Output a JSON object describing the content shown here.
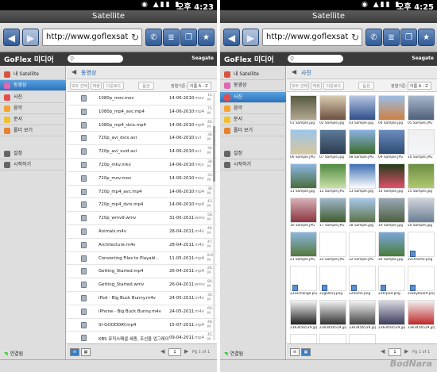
{
  "left": {
    "status": {
      "time": "오후 4:23"
    },
    "window_title": "Satellite",
    "url": "http://www.goflexsat",
    "app_name": "GoFlex 미디어",
    "brand": "Seagate",
    "sidebar": [
      {
        "label": "내 Satellite",
        "color": "#d9533d",
        "selected": false
      },
      {
        "label": "동영상",
        "color": "#e266b4",
        "selected": true
      },
      {
        "label": "사진",
        "color": "#e74c4c",
        "selected": false
      },
      {
        "label": "음악",
        "color": "#f2a531",
        "selected": false
      },
      {
        "label": "문서",
        "color": "#f0c02d",
        "selected": false
      },
      {
        "label": "폴더 보기",
        "color": "#e8822b",
        "selected": false
      },
      {
        "label": "설정",
        "color": "#666666",
        "selected": false
      },
      {
        "label": "시작하기",
        "color": "#666666",
        "selected": false
      }
    ],
    "footer_label": "연결됨",
    "section_title": "동영상",
    "toolbar": {
      "btn1": "모두 선택",
      "btn2": "재생",
      "btn3": "다운로드",
      "btn4": "옵션",
      "sort_label": "정렬기준:",
      "sort_value": "이름 A - Z"
    },
    "files": [
      {
        "name": "1080p_mov.mov",
        "date": "14-06-2010",
        "ext": "mov",
        "size": "14.7 M"
      },
      {
        "name": "1080p_mp4_avc.mp4",
        "date": "14-06-2010",
        "ext": "mp4",
        "size": "75.1 M"
      },
      {
        "name": "1080p_mp4_dvix.mp4",
        "date": "14-06-2010",
        "ext": "mp4",
        "size": "46.5 M"
      },
      {
        "name": "720p_avi_dvix.avi",
        "date": "14-06-2010",
        "ext": "avi",
        "size": "38.8 M"
      },
      {
        "name": "720p_avi_xvid.avi",
        "date": "14-06-2010",
        "ext": "avi",
        "size": "34.7 M"
      },
      {
        "name": "720p_mkv.mkv",
        "date": "14-06-2010",
        "ext": "mkv",
        "size": "38.6 M"
      },
      {
        "name": "720p_mov.mov",
        "date": "14-06-2010",
        "ext": "mov",
        "size": "33.5 M"
      },
      {
        "name": "720p_mp4_avc.mp4",
        "date": "14-06-2010",
        "ext": "mp4",
        "size": "38.6 M"
      },
      {
        "name": "720p_mp4_dvix.mp4",
        "date": "14-06-2010",
        "ext": "mp4",
        "size": "43.6 M"
      },
      {
        "name": "720p_wmv9.wmv",
        "date": "31-05-2011",
        "ext": "wmv",
        "size": "58.9 M"
      },
      {
        "name": "Animals.m4v",
        "date": "28-04-2011",
        "ext": "m4v",
        "size": "46.5 M"
      },
      {
        "name": "Architecture.m4v",
        "date": "28-04-2011",
        "ext": "m4v",
        "size": "47.9 M"
      },
      {
        "name": "Converting Files to Playabl...",
        "date": "11-05-2011",
        "ext": "mp4",
        "size": "8.6 M"
      },
      {
        "name": "Getting_Started.mp4",
        "date": "26-04-2011",
        "ext": "mp4",
        "size": "26.7 M"
      },
      {
        "name": "Getting_Started.wmv",
        "date": "26-04-2011",
        "ext": "wmv",
        "size": "80.0 M"
      },
      {
        "name": "iPod - Big Buck Bunny.m4v",
        "date": "24-05-2011",
        "ext": "m4v",
        "size": "36.3 M"
      },
      {
        "name": "iPhone - Big Buck Bunny.m4v",
        "date": "24-05-2011",
        "ext": "m4v",
        "size": "60.3 M"
      },
      {
        "name": "SI-GOODDAY.mp4",
        "date": "15-07-2011",
        "ext": "mp4",
        "size": "48.4 M"
      },
      {
        "name": "KBS 뮤직스페셜 세종, 조선을 업그레이드하다.mp4",
        "date": "09-04-2011",
        "ext": "mp4",
        "size": "45.4 M"
      }
    ],
    "page": {
      "current": "1",
      "label": "Pg 1 of 1"
    }
  },
  "right": {
    "status": {
      "time": "오후 4:25"
    },
    "window_title": "Satellite",
    "url": "http://www.goflexsat",
    "app_name": "GoFlex 미디어",
    "brand": "Seagate",
    "section_title": "사진",
    "sidebar": [
      {
        "label": "내 Satellite",
        "color": "#d9533d",
        "selected": false
      },
      {
        "label": "동영상",
        "color": "#e266b4",
        "selected": false
      },
      {
        "label": "사진",
        "color": "#e74c4c",
        "selected": true
      },
      {
        "label": "음악",
        "color": "#f2a531",
        "selected": false
      },
      {
        "label": "문서",
        "color": "#f0c02d",
        "selected": false
      },
      {
        "label": "폴더 보기",
        "color": "#e8822b",
        "selected": false
      },
      {
        "label": "설정",
        "color": "#666666",
        "selected": false
      },
      {
        "label": "시작하기",
        "color": "#666666",
        "selected": false
      }
    ],
    "footer_label": "연결됨",
    "toolbar": {
      "btn1": "모두 선택",
      "btn2": "재생",
      "btn3": "다운로드",
      "btn4": "옵션",
      "sort_label": "정렬기준:",
      "sort_value": "이름 A - Z"
    },
    "photos": [
      {
        "name": "01 Sample.jpg",
        "c1": "#555a40",
        "c2": "#b4a890"
      },
      {
        "name": "02 Sample.jpg",
        "c1": "#d8cbb0",
        "c2": "#6c5040"
      },
      {
        "name": "03 Sample.jpg",
        "c1": "#b8c6e2",
        "c2": "#2d4d8a"
      },
      {
        "name": "04 Sample.jpg",
        "c1": "#9bbde6",
        "c2": "#cf8040"
      },
      {
        "name": "05 Sample.JPG",
        "c1": "#a7b7cb",
        "c2": "#4f5f78"
      },
      {
        "name": "06 Sample.JPG",
        "c1": "#9cc6ea",
        "c2": "#d8c69a"
      },
      {
        "name": "07 Sample.jpg",
        "c1": "#5d7a9a",
        "c2": "#2b3b4d"
      },
      {
        "name": "08 Sample.JPG",
        "c1": "#8ab2e2",
        "c2": "#3c6a2a"
      },
      {
        "name": "09 Sample.JPG",
        "c1": "#6c8cbe",
        "c2": "#2c4c74"
      },
      {
        "name": "10 Sample.JPG",
        "c1": "#efefef",
        "c2": "#f4f6fa"
      },
      {
        "name": "11 Sample.jpg",
        "c1": "#8cb6e2",
        "c2": "#4a6c3c"
      },
      {
        "name": "12 Sample.JPG",
        "c1": "#4e8a40",
        "c2": "#c8e0a8"
      },
      {
        "name": "13 Sample.jpg",
        "c1": "#3d6fb3",
        "c2": "#ffffff"
      },
      {
        "name": "14 Sample.jpg",
        "c1": "#233c1a",
        "c2": "#e0506a"
      },
      {
        "name": "15 Sample.jpg",
        "c1": "#6c8e42",
        "c2": "#b0c870"
      },
      {
        "name": "16 Sample.JPG",
        "c1": "#d6b0b6",
        "c2": "#8c3640"
      },
      {
        "name": "17 Sample.JPG",
        "c1": "#a0b6cc",
        "c2": "#405c2c"
      },
      {
        "name": "18 Sample.jpg",
        "c1": "#a8c8ea",
        "c2": "#5c7248"
      },
      {
        "name": "19 Sample.jpg",
        "c1": "#9aa8b6",
        "c2": "#4c6040"
      },
      {
        "name": "20 Sample.jpg",
        "c1": "#d0d4dc",
        "c2": "#6a7e92"
      },
      {
        "name": "21 Sample.JPG",
        "c1": "#8ab6de",
        "c2": "#56783c"
      },
      {
        "name": "22 Sample.JPG",
        "c1": "#ffffff",
        "c2": "#ffffff"
      },
      {
        "name": "22 Sample.JPG",
        "c1": "#ffffff",
        "c2": "#ffffff"
      },
      {
        "name": "26 Sample.jpg",
        "c1": "#7aa8dc",
        "c2": "#4a7c3a"
      },
      {
        "name": "22chrome.png",
        "c1": "#ffffff",
        "c2": "#ffffff",
        "file": true
      },
      {
        "name": "22exchange.png",
        "c1": "#ffffff",
        "c2": "#ffffff",
        "file": true
      },
      {
        "name": "22gallery.png",
        "c1": "#ffffff",
        "c2": "#ffffff",
        "file": true
      },
      {
        "name": "22home.png",
        "c1": "#ffffff",
        "c2": "#ffffff",
        "file": true
      },
      {
        "name": "22tripod.png",
        "c1": "#ffffff",
        "c2": "#ffffff",
        "file": true
      },
      {
        "name": "22keyboard.png",
        "c1": "#ffffff",
        "c2": "#ffffff",
        "file": true
      },
      {
        "name": "2363456529.jpg",
        "c1": "#f4f4f4",
        "c2": "#222222"
      },
      {
        "name": "2363456529.jpg",
        "c1": "#f4f4f4",
        "c2": "#333333"
      },
      {
        "name": "2363456529.jpg",
        "c1": "#f6f6f6",
        "c2": "#444444"
      },
      {
        "name": "2363456529.jpg",
        "c1": "#d8d8e4",
        "c2": "#3c3c5a"
      },
      {
        "name": "2363456529.jpg",
        "c1": "#f2f2f2",
        "c2": "#c02828"
      },
      {
        "name": "2x1 Widget Y...",
        "c1": "#ffffff",
        "c2": "#ffffff",
        "file": true
      },
      {
        "name": "2x1 Widget Y...",
        "c1": "#ffffff",
        "c2": "#ffffff",
        "file": true
      },
      {
        "name": "2x1 Widget Y...",
        "c1": "#ffffff",
        "c2": "#ffffff",
        "file": true
      }
    ],
    "page": {
      "current": "1",
      "label": "Pg 1 of 1"
    }
  },
  "watermark": "BodNara"
}
